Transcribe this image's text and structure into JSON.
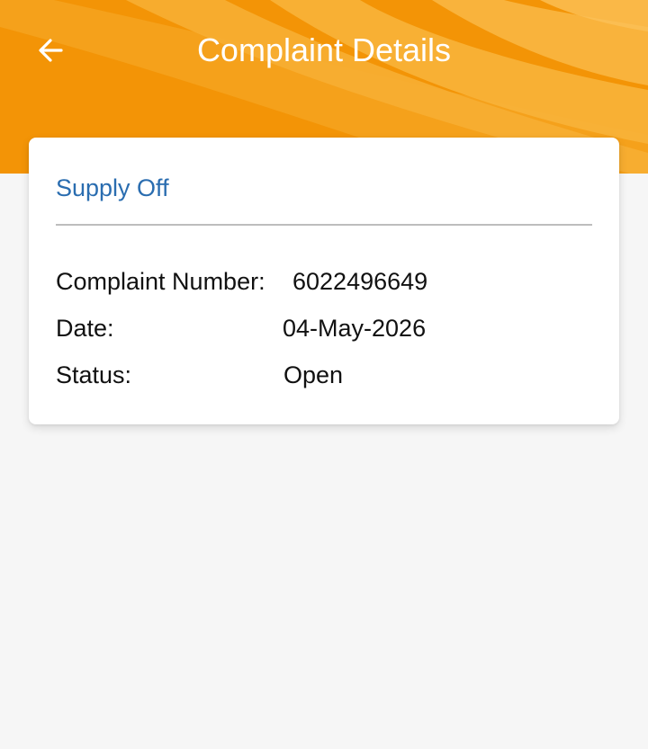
{
  "header": {
    "title": "Complaint Details",
    "back_icon": "arrow-left-icon",
    "background_color": "#f39406"
  },
  "card": {
    "title": "Supply Off",
    "title_color": "#2a6db0",
    "fields": {
      "complaint_number": {
        "label": "Complaint Number:",
        "value": "6022496649"
      },
      "date": {
        "label": "Date:",
        "value": "04-May-2026"
      },
      "status": {
        "label": "Status:",
        "value": "Open"
      }
    }
  }
}
